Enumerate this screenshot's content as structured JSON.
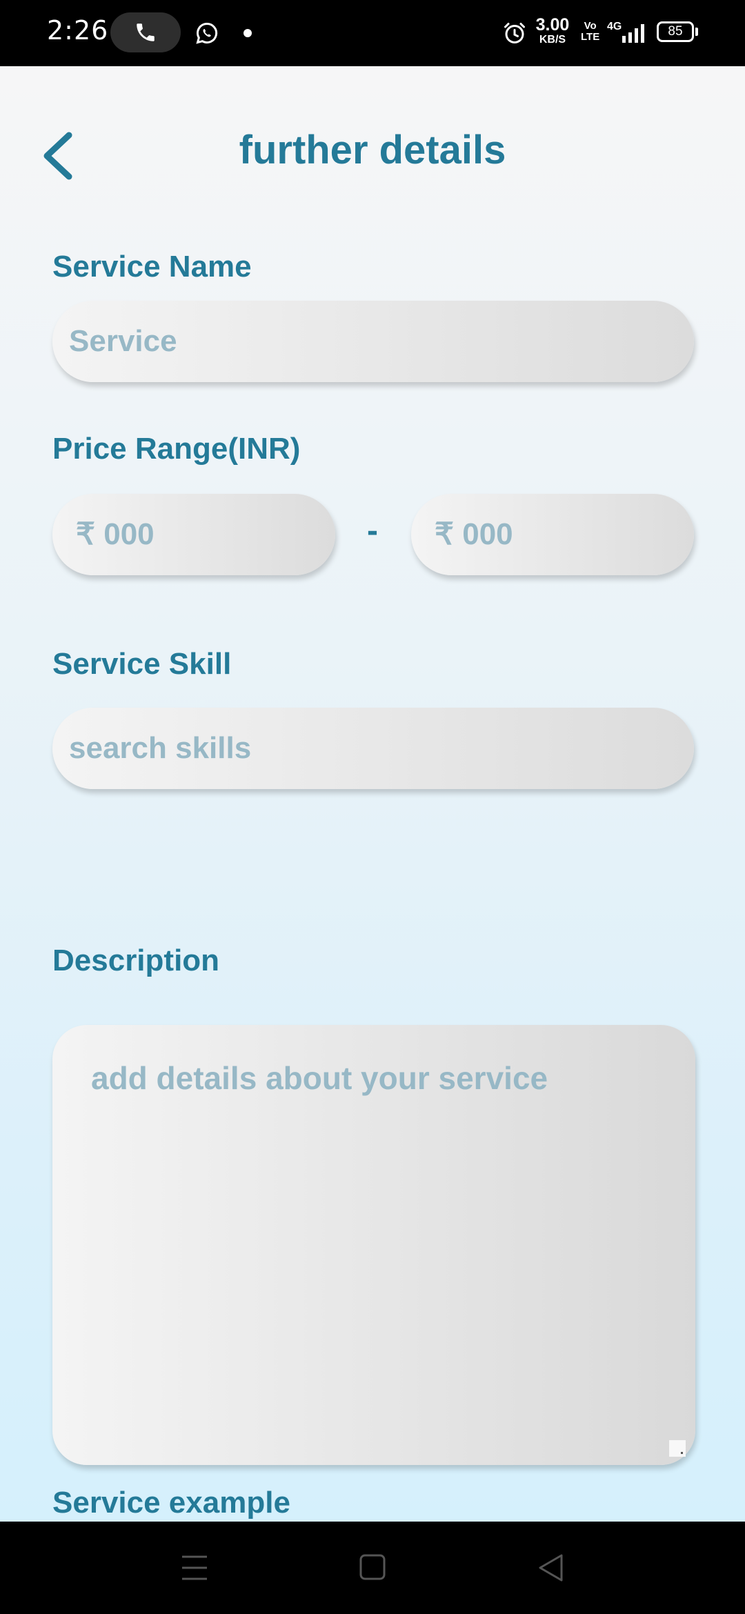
{
  "status_bar": {
    "time": "2:26",
    "speed_value": "3.00",
    "speed_unit": "KB/S",
    "volte_top": "Vo",
    "volte_bottom": "LTE",
    "network": "4G",
    "battery": "85",
    "icons": [
      "phone-call-icon",
      "whatsapp-icon",
      "notification-dot-icon",
      "alarm-icon",
      "signal-icon",
      "battery-icon"
    ]
  },
  "header": {
    "title": "further details",
    "back_icon": "chevron-left-icon"
  },
  "form": {
    "service_name_label": "Service Name",
    "service_name_placeholder": "Service",
    "price_range_label": "Price Range(INR)",
    "price_min_placeholder": "₹ 000",
    "price_separator": "-",
    "price_max_placeholder": "₹ 000",
    "service_skill_label": "Service Skill",
    "skill_placeholder": "search skills",
    "description_label": "Description",
    "description_placeholder": "add details about your service",
    "service_example_label": "Service example"
  },
  "nav_bar": {
    "icons": [
      "menu-icon",
      "home-square-icon",
      "back-triangle-icon"
    ]
  },
  "colors": {
    "accent": "#247a98",
    "placeholder": "#97b8c6",
    "background_top": "#f6f6f7",
    "background_bottom": "#d5f0fc"
  }
}
